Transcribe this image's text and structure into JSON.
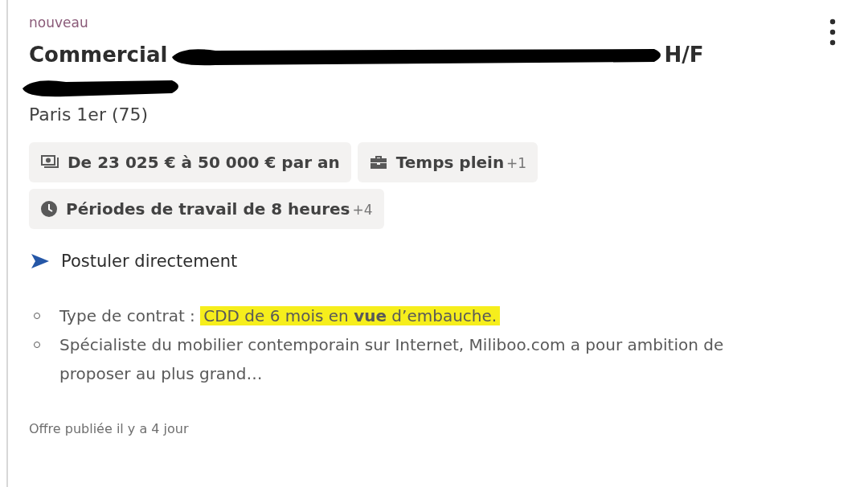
{
  "badge": "nouveau",
  "title": {
    "start": "Commercial",
    "end": "H/F"
  },
  "location": "Paris 1er (75)",
  "tags": [
    {
      "kind": "money",
      "label": "De 23 025 € à 50 000 € par an"
    },
    {
      "kind": "briefcase",
      "label": "Temps plein",
      "extra": "+1"
    },
    {
      "kind": "clock",
      "label": "Périodes de travail de 8 heures",
      "extra": "+4"
    }
  ],
  "apply": "Postuler directement",
  "snippets": [
    {
      "label": "Type de contrat :",
      "highlight": "CDD de 6 mois en **vue** d’embauche."
    },
    {
      "label": "Spécialiste du mobilier contemporain sur Internet, Miliboo.com a pour ambition de proposer au plus grand…"
    }
  ],
  "footer": "Offre publiée il y a 4 jour"
}
